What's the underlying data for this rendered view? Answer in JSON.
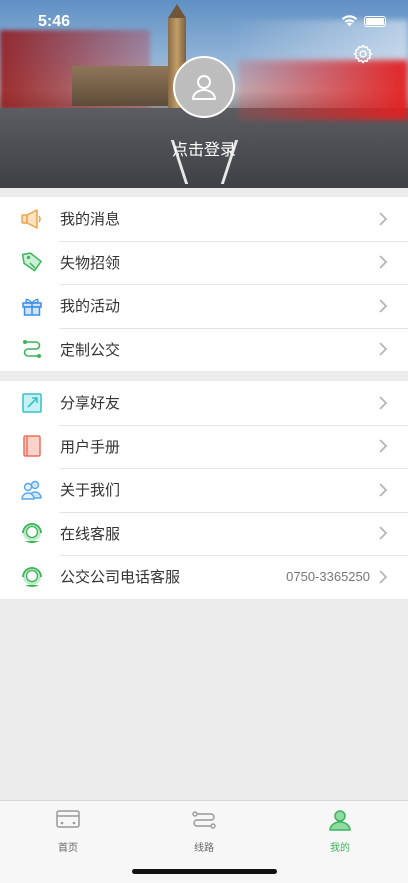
{
  "status": {
    "time": "5:46"
  },
  "profile": {
    "login_label": "点击登录"
  },
  "menu": {
    "group1": [
      {
        "label": "我的消息",
        "icon": "megaphone-icon",
        "color": "#f0a14b"
      },
      {
        "label": "失物招领",
        "icon": "tag-icon",
        "color": "#3cb45a"
      },
      {
        "label": "我的活动",
        "icon": "gift-icon",
        "color": "#3a8ee6"
      },
      {
        "label": "定制公交",
        "icon": "route-icon",
        "color": "#3cb45a"
      }
    ],
    "group2": [
      {
        "label": "分享好友",
        "icon": "share-icon",
        "color": "#35c2c9"
      },
      {
        "label": "用户手册",
        "icon": "manual-book-icon",
        "color": "#ef6e5a"
      },
      {
        "label": "关于我们",
        "icon": "people-icon",
        "color": "#5aa7e8"
      },
      {
        "label": "在线客服",
        "icon": "headset-agent-icon",
        "color": "#3cb45a"
      },
      {
        "label": "公交公司电话客服",
        "icon": "headset-agent-icon",
        "color": "#3cb45a",
        "value": "0750-3365250"
      }
    ]
  },
  "tabs": [
    {
      "label": "首页",
      "icon": "bus-icon"
    },
    {
      "label": "线路",
      "icon": "route-line-icon"
    },
    {
      "label": "我的",
      "icon": "user-icon",
      "active": true
    }
  ],
  "colors": {
    "accent": "#3cb45a",
    "background": "#ebebeb"
  }
}
